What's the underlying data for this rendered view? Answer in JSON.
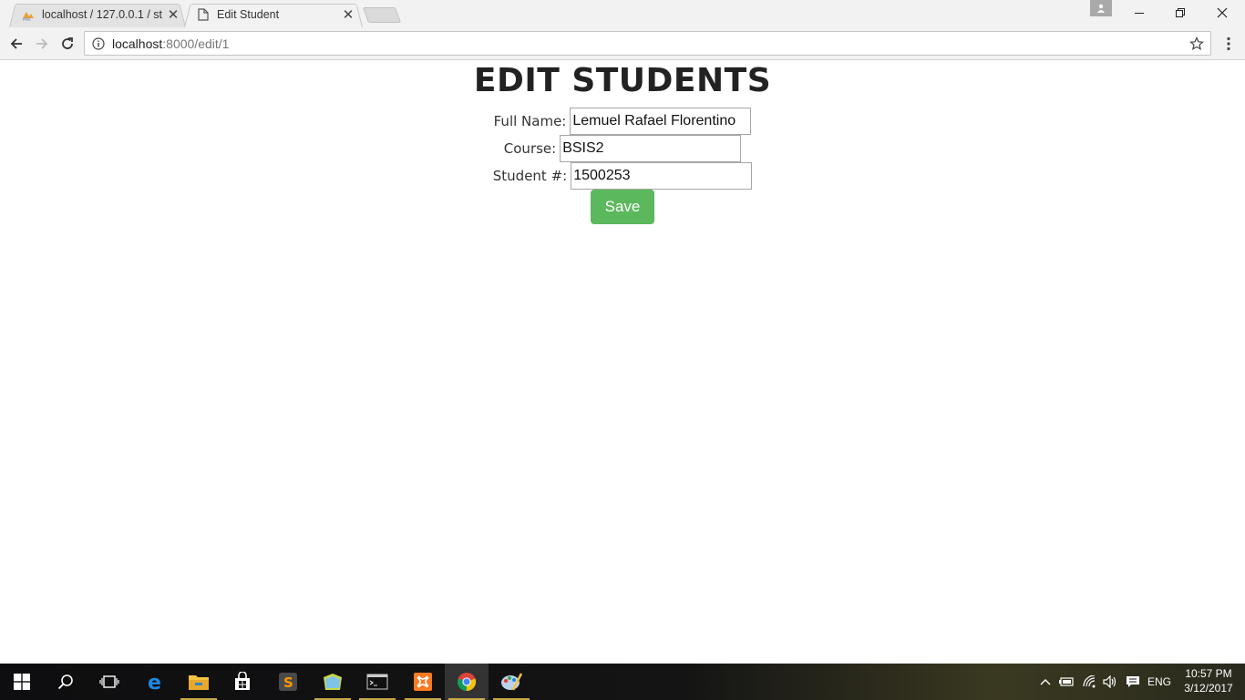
{
  "browser": {
    "tabs": [
      {
        "title": "localhost / 127.0.0.1 / stu",
        "favicon": "phpmyadmin-icon",
        "active": false
      },
      {
        "title": "Edit Student",
        "favicon": "document-icon",
        "active": true
      }
    ],
    "url_host": "localhost",
    "url_path": ":8000/edit/1"
  },
  "page": {
    "heading": "EDIT STUDENTS",
    "fields": {
      "full_name": {
        "label": "Full Name:",
        "value": "Lemuel Rafael Florentino"
      },
      "course": {
        "label": "Course:",
        "value": "BSIS2"
      },
      "student_no": {
        "label": "Student #:",
        "value": "1500253"
      }
    },
    "save_label": "Save",
    "save_color": "#5cb85c"
  },
  "taskbar": {
    "apps": [
      "start-icon",
      "search-icon",
      "task-view-icon",
      "edge-icon",
      "file-explorer-icon",
      "store-icon",
      "sublime-text-icon",
      "folder-app-icon",
      "terminal-icon",
      "xampp-icon",
      "chrome-icon",
      "paint-icon"
    ],
    "language": "ENG",
    "time": "10:57 PM",
    "date": "3/12/2017"
  }
}
